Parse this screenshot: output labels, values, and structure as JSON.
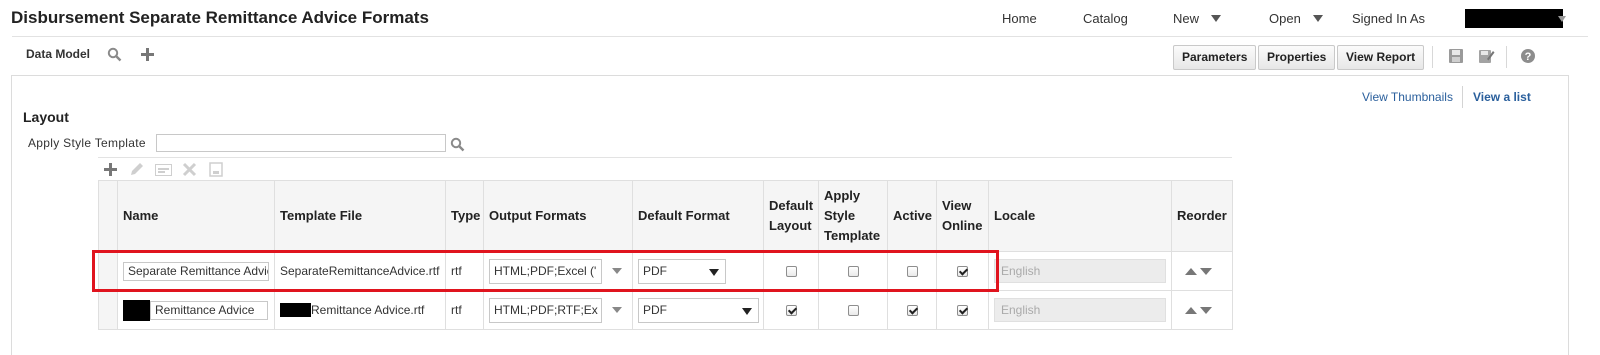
{
  "header": {
    "title": "Disbursement Separate Remittance Advice Formats",
    "nav": {
      "home": "Home",
      "catalog": "Catalog",
      "new": "New",
      "open": "Open",
      "signed_in_as": "Signed In As"
    }
  },
  "toolbar": {
    "data_model": "Data Model",
    "parameters": "Parameters",
    "properties": "Properties",
    "view_report": "View Report"
  },
  "view_links": {
    "thumbnails": "View Thumbnails",
    "list": "View a list"
  },
  "layout": {
    "heading": "Layout",
    "apply_style_label": "Apply Style Template",
    "apply_style_value": ""
  },
  "table": {
    "headers": {
      "name": "Name",
      "template_file": "Template File",
      "type": "Type",
      "output_formats": "Output Formats",
      "default_format": "Default Format",
      "default_layout": "Default Layout",
      "apply_style_template": "Apply Style Template",
      "active": "Active",
      "view_online": "View Online",
      "locale": "Locale",
      "reorder": "Reorder"
    },
    "rows": [
      {
        "name": "Separate Remittance Advic",
        "template_file": "SeparateRemittanceAdvice.rtf",
        "type": "rtf",
        "output_formats": "HTML;PDF;Excel ('",
        "default_format": "PDF",
        "default_layout": false,
        "apply_style_template": false,
        "active": false,
        "view_online": true,
        "locale": "English"
      },
      {
        "name": "Remittance Advice",
        "template_file": "Remittance Advice.rtf",
        "type": "rtf",
        "output_formats": "HTML;PDF;RTF;Ex",
        "default_format": "PDF",
        "default_layout": true,
        "apply_style_template": false,
        "active": true,
        "view_online": true,
        "locale": "English"
      }
    ]
  },
  "colors": {
    "link": "#2a5f9c",
    "highlight": "#e0141e",
    "header_bg": "#f5f5f5"
  }
}
